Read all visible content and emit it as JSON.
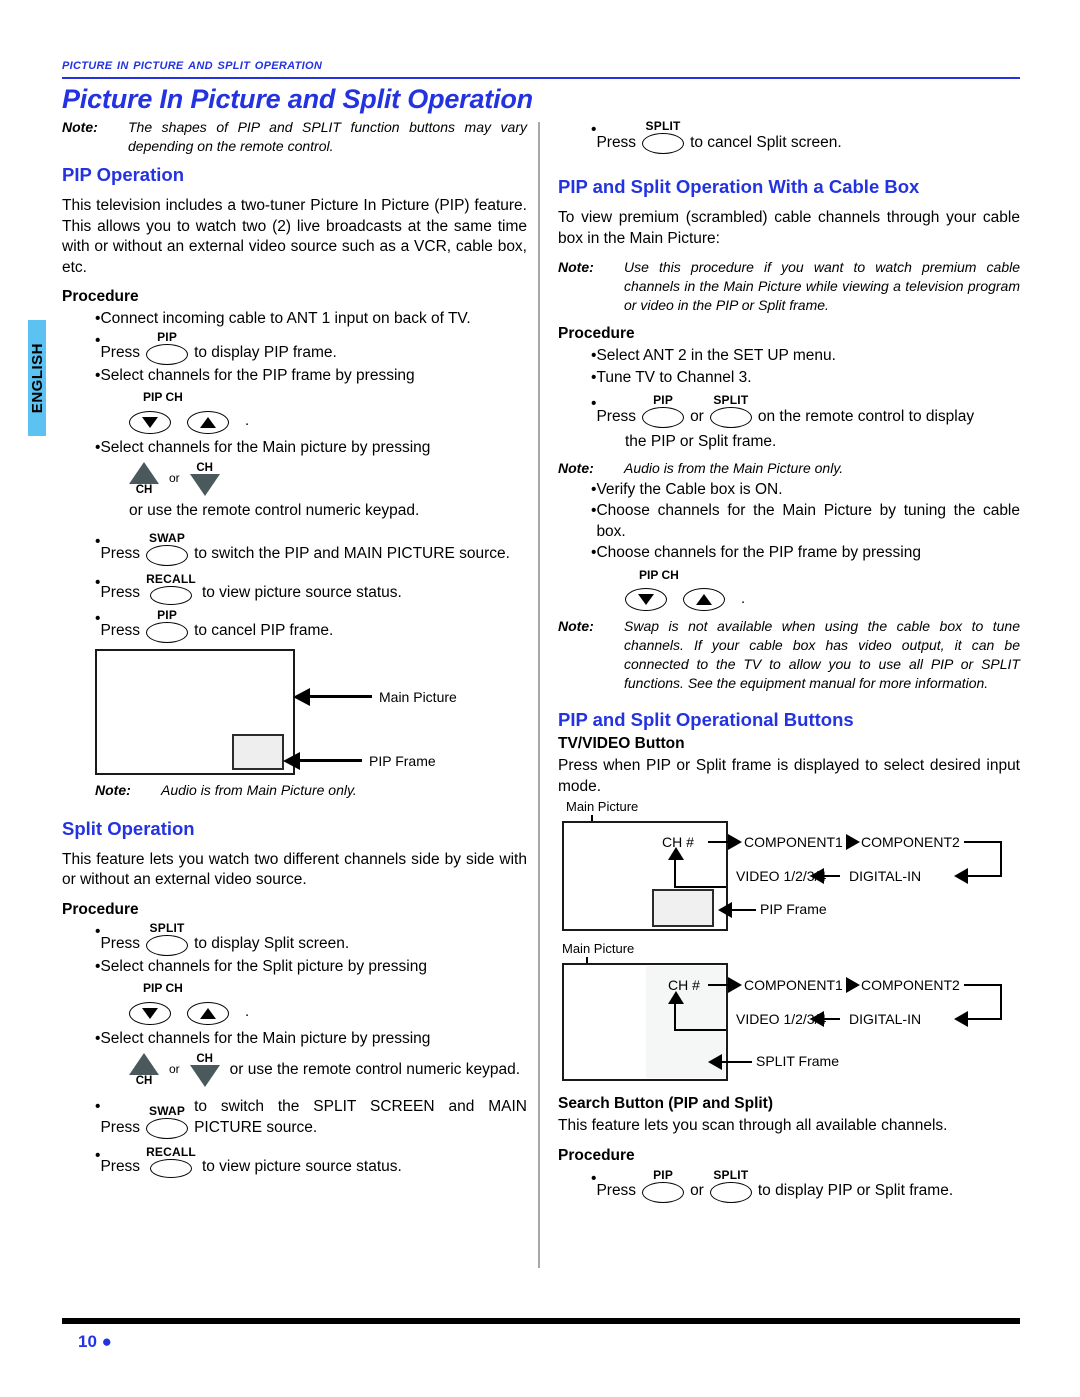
{
  "header": {
    "running_head": "Picture In Picture and Split Operation",
    "title": "Picture In Picture and Split Operation"
  },
  "language_tab": {
    "label": "ENGLISH"
  },
  "footer": {
    "page_number": "10",
    "bullet": "●"
  },
  "top_note": {
    "label": "Note:",
    "text": "The shapes of PIP and SPLIT function buttons may vary depending on the remote control."
  },
  "left_column": {
    "pip_operation": {
      "heading": "PIP Operation",
      "intro": "This television includes a two-tuner Picture In Picture (PIP) feature. This allows you to watch two (2) live broadcasts at the same time with or without an external video source such as a VCR, cable box, etc.",
      "procedure_heading": "Procedure",
      "steps": {
        "s1": "Connect incoming cable to ANT 1 input on back of TV.",
        "s2_press": "Press",
        "s2_btn": "PIP",
        "s2_tail": "to display PIP frame.",
        "s3": "Select channels for the PIP frame by pressing",
        "s3_btn_caption": "PIP CH",
        "s3_period": ".",
        "s4": "Select channels for the Main picture by pressing",
        "s4_ch_up": "CH",
        "s4_or": "or",
        "s4_ch_dn": "CH",
        "s4_tail": "or use the remote control numeric keypad.",
        "s5_press": "Press",
        "s5_btn": "SWAP",
        "s5_tail": "to switch the PIP and MAIN PICTURE source.",
        "s6_press": "Press",
        "s6_btn": "RECALL",
        "s6_tail": "to view picture source status.",
        "s7_press": "Press",
        "s7_btn": "PIP",
        "s7_tail": "to cancel PIP frame."
      },
      "diagram": {
        "main_picture_label": "Main Picture",
        "pip_frame_label": "PIP Frame"
      },
      "note": {
        "label": "Note:",
        "text": "Audio is from Main Picture only."
      }
    },
    "split_operation": {
      "heading": "Split Operation",
      "intro": "This feature lets you watch two different channels side by side with or without an external video source.",
      "procedure_heading": "Procedure",
      "steps": {
        "s1_press": "Press",
        "s1_btn": "SPLIT",
        "s1_tail": "to display Split screen.",
        "s2": "Select channels for the Split picture by pressing",
        "s2_btn_caption": "PIP CH",
        "s2_period": ".",
        "s3": "Select channels for the Main picture by pressing",
        "s3_ch_up": "CH",
        "s3_or": "or",
        "s3_ch_dn": "CH",
        "s3_tail": "or use the remote control numeric keypad.",
        "s4_press": "Press",
        "s4_btn": "SWAP",
        "s4_tail": "to switch the SPLIT SCREEN and MAIN PICTURE source.",
        "s5_press": "Press",
        "s5_btn": "RECALL",
        "s5_tail": "to view picture source status."
      }
    }
  },
  "right_column": {
    "split_cancel": {
      "press": "Press",
      "btn": "SPLIT",
      "tail": "to cancel Split screen."
    },
    "cable_box": {
      "heading": "PIP and Split Operation With a Cable Box",
      "intro": "To view premium (scrambled) cable channels through your cable box in the Main Picture:",
      "note1": {
        "label": "Note:",
        "text": "Use this procedure if you want to watch premium cable channels in the Main Picture while viewing a television program or video in the PIP or Split frame."
      },
      "procedure_heading": "Procedure",
      "steps": {
        "s1": "Select ANT 2 in the SET UP menu.",
        "s2": "Tune TV to Channel 3.",
        "s3_press": "Press",
        "s3_btn_a": "PIP",
        "s3_or": "or",
        "s3_btn_b": "SPLIT",
        "s3_tail": "on the remote control to display",
        "s3_cont": "the PIP or Split frame."
      },
      "note2": {
        "label": "Note:",
        "text": "Audio is from the Main Picture only."
      },
      "steps2": {
        "s4": "Verify the Cable box is ON.",
        "s5": "Choose channels for the Main Picture by tuning the cable box.",
        "s6": "Choose channels for the PIP frame by pressing",
        "s6_btn_caption": "PIP CH",
        "s6_period": "."
      },
      "note3": {
        "label": "Note:",
        "text": "Swap is not available when using the cable box to tune channels. If your cable box has video output, it can be connected to the TV to allow you to use all PIP or SPLIT functions. See the equipment manual for more information."
      }
    },
    "operational_buttons": {
      "heading": "PIP and Split Operational Buttons",
      "tv_video": {
        "subheading": "TV/VIDEO Button",
        "text": "Press when PIP or Split frame is displayed to select desired input mode."
      },
      "diagram_pip": {
        "main_picture_label": "Main Picture",
        "ch_label": "CH #",
        "component1": "COMPONENT1",
        "component2": "COMPONENT2",
        "video_label": "VIDEO 1/2/3/4",
        "digital_in": "DIGITAL-IN",
        "frame_label": "PIP Frame"
      },
      "diagram_split": {
        "main_picture_label": "Main Picture",
        "ch_label": "CH #",
        "component1": "COMPONENT1",
        "component2": "COMPONENT2",
        "video_label": "VIDEO 1/2/3/4",
        "digital_in": "DIGITAL-IN",
        "frame_label": "SPLIT Frame"
      },
      "search_button": {
        "subheading": "Search Button (PIP and Split)",
        "text": "This feature lets you scan through all available channels.",
        "procedure_heading": "Procedure",
        "press": "Press",
        "btn_a": "PIP",
        "or": "or",
        "btn_b": "SPLIT",
        "tail": "to display PIP or Split frame."
      }
    }
  }
}
